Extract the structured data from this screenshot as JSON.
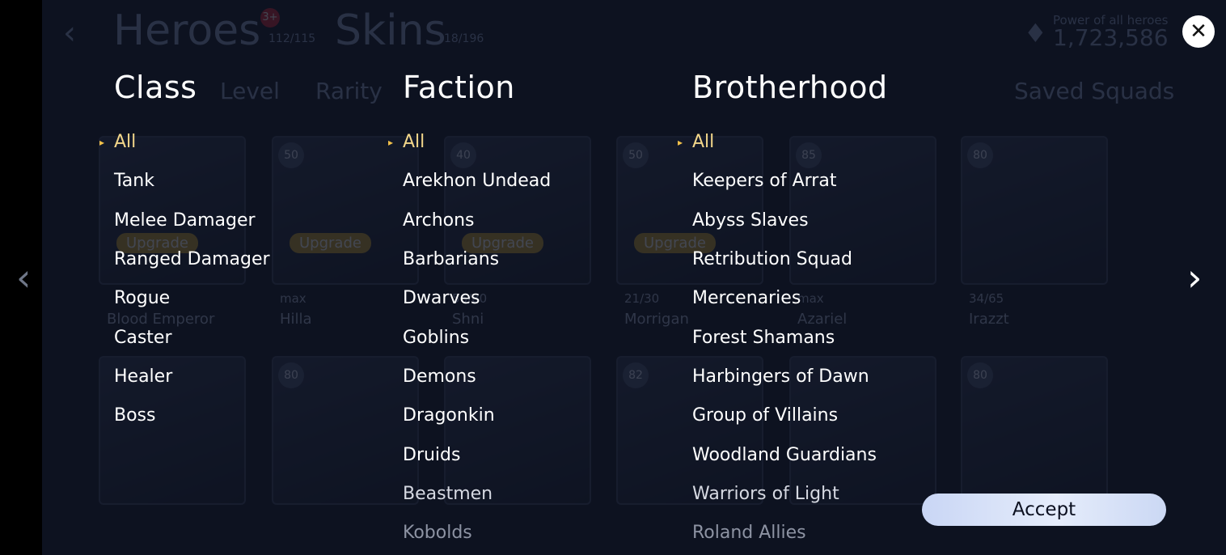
{
  "background": {
    "back_glyph": "‹",
    "heroes_tab": "Heroes",
    "heroes_badge": "3+",
    "heroes_count": "112/115",
    "skins_tab": "Skins",
    "skins_count": "18/196",
    "power_label": "Power of all heroes",
    "power_value": "1,723,586",
    "power_icon": "♦",
    "tab_level": "Level",
    "tab_rarity": "Rarity",
    "saved_squads": "Saved Squads",
    "upgrade_label": "Upgrade",
    "heroes": [
      {
        "level": "",
        "name": "Blood Emperor",
        "progress": ""
      },
      {
        "level": "50",
        "name": "Hilla",
        "progress": "max"
      },
      {
        "level": "40",
        "name": "Shni",
        "progress": "56/80"
      },
      {
        "level": "50",
        "name": "Morrigan",
        "progress": "21/30"
      },
      {
        "level": "85",
        "name": "Azariel",
        "progress": "max"
      },
      {
        "level": "80",
        "name": "Irazzt",
        "progress": "34/65"
      },
      {
        "level": "80",
        "name": "",
        "progress": ""
      },
      {
        "level": "82",
        "name": "",
        "progress": ""
      },
      {
        "level": "80",
        "name": "",
        "progress": ""
      }
    ]
  },
  "filters": {
    "class": {
      "title": "Class",
      "options": [
        "All",
        "Tank",
        "Melee Damager",
        "Ranged Damager",
        "Rogue",
        "Caster",
        "Healer",
        "Boss"
      ],
      "selected": "All"
    },
    "faction": {
      "title": "Faction",
      "options": [
        "All",
        "Arekhon Undead",
        "Archons",
        "Barbarians",
        "Dwarves",
        "Goblins",
        "Demons",
        "Dragonkin",
        "Druids",
        "Beastmen",
        "Kobolds"
      ],
      "selected": "All"
    },
    "brotherhood": {
      "title": "Brotherhood",
      "options": [
        "All",
        "Keepers of Arrat",
        "Abyss Slaves",
        "Retribution Squad",
        "Mercenaries",
        "Forest Shamans",
        "Harbingers of Dawn",
        "Group of Villains",
        "Woodland Guardians",
        "Warriors of Light",
        "Roland Allies"
      ],
      "selected": "All"
    }
  },
  "controls": {
    "close_glyph": "✕",
    "prev_glyph": "‹",
    "next_glyph": "›",
    "accept_label": "Accept"
  },
  "colors": {
    "selected_option": "#f2d68a",
    "marker": "#f2c14a",
    "accept_bg": "#dbe4f8",
    "overlay_bg": "#0d1220"
  }
}
